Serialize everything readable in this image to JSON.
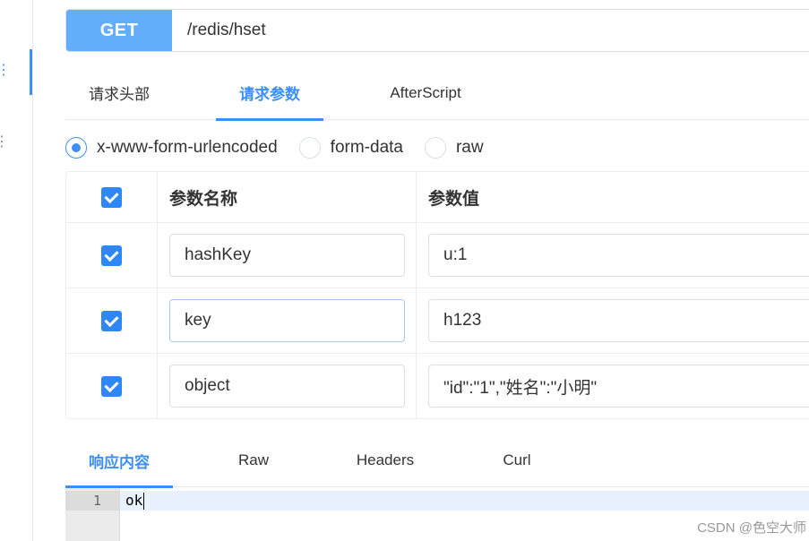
{
  "request": {
    "method": "GET",
    "url": "/redis/hset"
  },
  "request_tabs": [
    {
      "label": "请求头部",
      "active": false
    },
    {
      "label": "请求参数",
      "active": true
    },
    {
      "label": "AfterScript",
      "active": false
    }
  ],
  "body_type": {
    "options": [
      "x-www-form-urlencoded",
      "form-data",
      "raw"
    ],
    "selected": "x-www-form-urlencoded"
  },
  "params": {
    "headers": {
      "name": "参数名称",
      "value": "参数值"
    },
    "rows": [
      {
        "checked": true,
        "name": "hashKey",
        "value": "u:1"
      },
      {
        "checked": true,
        "name": "key",
        "value": "h123"
      },
      {
        "checked": true,
        "name": "object",
        "value": "\"id\":\"1\",\"姓名\":\"小明\""
      }
    ]
  },
  "response_tabs": [
    {
      "label": "响应内容",
      "active": true
    },
    {
      "label": "Raw",
      "active": false
    },
    {
      "label": "Headers",
      "active": false
    },
    {
      "label": "Curl",
      "active": false
    }
  ],
  "response": {
    "line_number": "1",
    "content": "ok"
  },
  "watermark": "CSDN @色空大师",
  "colors": {
    "accent": "#3b8ff6",
    "method_bg": "#62aefb"
  }
}
